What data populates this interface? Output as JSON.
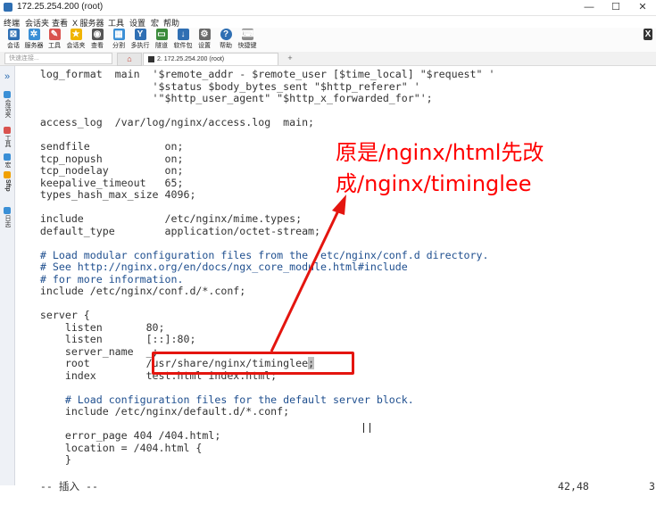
{
  "window": {
    "title": "172.25.254.200 (root)"
  },
  "menu": [
    "终端",
    "会话夹",
    "查看",
    "X 服务器",
    "工具",
    "设置",
    "宏",
    "帮助"
  ],
  "toolbar": [
    {
      "label": "会话",
      "icon": "session-icon",
      "color": "#2f6fb3"
    },
    {
      "label": "服务器",
      "icon": "servers-icon",
      "color": "#3a8fd6"
    },
    {
      "label": "工具",
      "icon": "tools-icon",
      "color": "#d9534f"
    },
    {
      "label": "会话夹",
      "icon": "star-icon",
      "color": "#f0b400"
    },
    {
      "label": "查看",
      "icon": "view-icon",
      "color": "#555555"
    },
    {
      "label": "分割",
      "icon": "split-icon",
      "color": "#3a8fd6"
    },
    {
      "label": "多执行",
      "icon": "multi-exec-icon",
      "color": "#2f6fb3"
    },
    {
      "label": "隧道",
      "icon": "tunnel-icon",
      "color": "#3b8a3b"
    },
    {
      "label": "软件包",
      "icon": "package-icon",
      "color": "#2f6fb3"
    },
    {
      "label": "设置",
      "icon": "gear-icon",
      "color": "#6a6a6a"
    },
    {
      "label": "帮助",
      "icon": "help-icon",
      "color": "#2f6fb3"
    },
    {
      "label": "快捷键",
      "icon": "keyboard-icon",
      "color": "#8a8a8a"
    }
  ],
  "session_bar": {
    "quick_connect_placeholder": "快速连接...",
    "session_tab_label": "2. 172.25.254.200 (root)",
    "new_tab": "+"
  },
  "sidebar": [
    "会话夹",
    "工具",
    "宏",
    "Sftp",
    "日志"
  ],
  "editor": {
    "lines": [
      "    log_format  main  '$remote_addr - $remote_user [$time_local] \"$request\" '",
      "                      '$status $body_bytes_sent \"$http_referer\" '",
      "                      '\"$http_user_agent\" \"$http_x_forwarded_for\"';",
      "",
      "    access_log  /var/log/nginx/access.log  main;",
      "",
      "    sendfile            on;",
      "    tcp_nopush          on;",
      "    tcp_nodelay         on;",
      "    keepalive_timeout   65;",
      "    types_hash_max_size 4096;",
      "",
      "    include             /etc/nginx/mime.types;",
      "    default_type        application/octet-stream;",
      "",
      "    # Load modular configuration files from the /etc/nginx/conf.d directory.",
      "    # See http://nginx.org/en/docs/ngx_core_module.html#include",
      "    # for more information.",
      "    include /etc/nginx/conf.d/*.conf;",
      "",
      "    server {",
      "        listen       80;",
      "        listen       [::]:80;",
      "        server_name  _;",
      "        root         /usr/share/nginx/timinglee",
      "        index        test.html index.html;",
      "",
      "        # Load configuration files for the default server block.",
      "        include /etc/nginx/default.d/*.conf;",
      "",
      "        error_page 404 /404.html;",
      "        location = /404.html {",
      "        }"
    ],
    "cursor_char": ";",
    "mode": "-- 插入 --",
    "position": "42,48",
    "percent": "3"
  },
  "annotation": {
    "line1": "原是/nginx/html先改",
    "line2": "成/nginx/timinglee",
    "color": "#ff0000"
  }
}
